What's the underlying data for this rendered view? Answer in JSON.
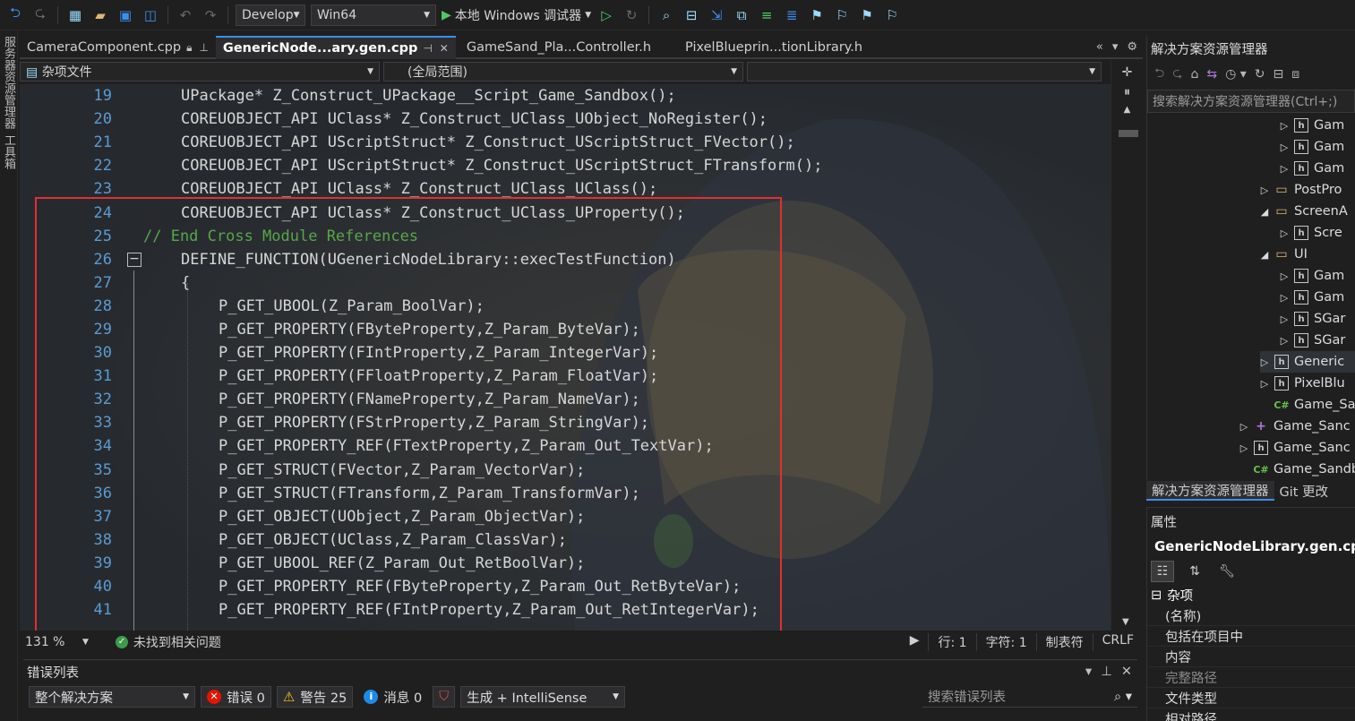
{
  "toolbar": {
    "config": "Develop",
    "platform": "Win64",
    "run_label": "本地 Windows 调试器"
  },
  "left_strip": {
    "label1": "服务器资源管理器",
    "label2": "工具箱"
  },
  "tabs": [
    {
      "label": "CameraComponent.cpp"
    },
    {
      "label": "GenericNode...ary.gen.cpp"
    },
    {
      "label": "GameSand_Pla...Controller.h"
    },
    {
      "label": "PixelBlueprin...tionLibrary.h"
    }
  ],
  "nav": {
    "project": "杂项文件",
    "scope": "(全局范围)"
  },
  "code": [
    {
      "ln": "19",
      "text": "UPackage* Z_Construct_UPackage__Script_Game_Sandbox();",
      "indent": 1,
      "type": "code"
    },
    {
      "ln": "20",
      "text": "COREUOBJECT_API UClass* Z_Construct_UClass_UObject_NoRegister();",
      "indent": 1,
      "type": "code"
    },
    {
      "ln": "21",
      "text": "COREUOBJECT_API UScriptStruct* Z_Construct_UScriptStruct_FVector();",
      "indent": 1,
      "type": "code"
    },
    {
      "ln": "22",
      "text": "COREUOBJECT_API UScriptStruct* Z_Construct_UScriptStruct_FTransform();",
      "indent": 1,
      "type": "code"
    },
    {
      "ln": "23",
      "text": "COREUOBJECT_API UClass* Z_Construct_UClass_UClass();",
      "indent": 1,
      "type": "code"
    },
    {
      "ln": "24",
      "text": "COREUOBJECT_API UClass* Z_Construct_UClass_UProperty();",
      "indent": 1,
      "type": "code"
    },
    {
      "ln": "25",
      "text": "// End Cross Module References",
      "indent": 0,
      "type": "comment"
    },
    {
      "ln": "26",
      "text": "DEFINE_FUNCTION(UGenericNodeLibrary::execTestFunction)",
      "indent": 1,
      "type": "code"
    },
    {
      "ln": "27",
      "text": "{",
      "indent": 1,
      "type": "code"
    },
    {
      "ln": "28",
      "text": "P_GET_UBOOL(Z_Param_BoolVar);",
      "indent": 2,
      "type": "code"
    },
    {
      "ln": "29",
      "text": "P_GET_PROPERTY(FByteProperty,Z_Param_ByteVar);",
      "indent": 2,
      "type": "code"
    },
    {
      "ln": "30",
      "text": "P_GET_PROPERTY(FIntProperty,Z_Param_IntegerVar);",
      "indent": 2,
      "type": "code"
    },
    {
      "ln": "31",
      "text": "P_GET_PROPERTY(FFloatProperty,Z_Param_FloatVar);",
      "indent": 2,
      "type": "code"
    },
    {
      "ln": "32",
      "text": "P_GET_PROPERTY(FNameProperty,Z_Param_NameVar);",
      "indent": 2,
      "type": "code"
    },
    {
      "ln": "33",
      "text": "P_GET_PROPERTY(FStrProperty,Z_Param_StringVar);",
      "indent": 2,
      "type": "code"
    },
    {
      "ln": "34",
      "text": "P_GET_PROPERTY_REF(FTextProperty,Z_Param_Out_TextVar);",
      "indent": 2,
      "type": "code"
    },
    {
      "ln": "35",
      "text": "P_GET_STRUCT(FVector,Z_Param_VectorVar);",
      "indent": 2,
      "type": "code"
    },
    {
      "ln": "36",
      "text": "P_GET_STRUCT(FTransform,Z_Param_TransformVar);",
      "indent": 2,
      "type": "code"
    },
    {
      "ln": "37",
      "text": "P_GET_OBJECT(UObject,Z_Param_ObjectVar);",
      "indent": 2,
      "type": "code"
    },
    {
      "ln": "38",
      "text": "P_GET_OBJECT(UClass,Z_Param_ClassVar);",
      "indent": 2,
      "type": "code"
    },
    {
      "ln": "39",
      "text": "P_GET_UBOOL_REF(Z_Param_Out_RetBoolVar);",
      "indent": 2,
      "type": "code"
    },
    {
      "ln": "40",
      "text": "P_GET_PROPERTY_REF(FByteProperty,Z_Param_Out_RetByteVar);",
      "indent": 2,
      "type": "code"
    },
    {
      "ln": "41",
      "text": "P_GET_PROPERTY_REF(FIntProperty,Z_Param_Out_RetIntegerVar);",
      "indent": 2,
      "type": "code"
    }
  ],
  "status": {
    "zoom": "131 %",
    "issues": "未找到相关问题",
    "line": "行: 1",
    "char": "字符: 1",
    "tabs": "制表符",
    "eol": "CRLF"
  },
  "error_list": {
    "title": "错误列表",
    "scope": "整个解决方案",
    "errors": "错误 0",
    "warnings": "警告 25",
    "messages": "消息 0",
    "build": "生成 + IntelliSense",
    "search_placeholder": "搜索错误列表"
  },
  "solution": {
    "title": "解决方案资源管理器",
    "search_placeholder": "搜索解决方案资源管理器(Ctrl+;)",
    "items": [
      {
        "label": "Gam",
        "icon": "h"
      },
      {
        "label": "Gam",
        "icon": "h"
      },
      {
        "label": "Gam",
        "icon": "h"
      },
      {
        "label": "PostPro",
        "icon": "folder"
      },
      {
        "label": "ScreenA",
        "icon": "folder"
      },
      {
        "label": "Scre",
        "icon": "h"
      },
      {
        "label": "UI",
        "icon": "folder"
      },
      {
        "label": "Gam",
        "icon": "h"
      },
      {
        "label": "Gam",
        "icon": "h"
      },
      {
        "label": "SGar",
        "icon": "h"
      },
      {
        "label": "SGar",
        "icon": "h"
      },
      {
        "label": "Generic",
        "icon": "h"
      },
      {
        "label": "PixelBlu",
        "icon": "h"
      },
      {
        "label": "Game_Sanc",
        "icon": "cs"
      },
      {
        "label": "Game_Sanc",
        "icon": "proj"
      },
      {
        "label": "Game_Sanc",
        "icon": "h"
      },
      {
        "label": "Game_Sandbo",
        "icon": "cs"
      }
    ],
    "tab_active": "解决方案资源管理器",
    "tab_other": "Git 更改"
  },
  "properties": {
    "title": "属性",
    "file": "GenericNodeLibrary.gen.cpp",
    "category": "杂项",
    "rows": [
      "(名称)",
      "包括在项目中",
      "内容",
      "完整路径",
      "文件类型",
      "相对路径"
    ]
  }
}
